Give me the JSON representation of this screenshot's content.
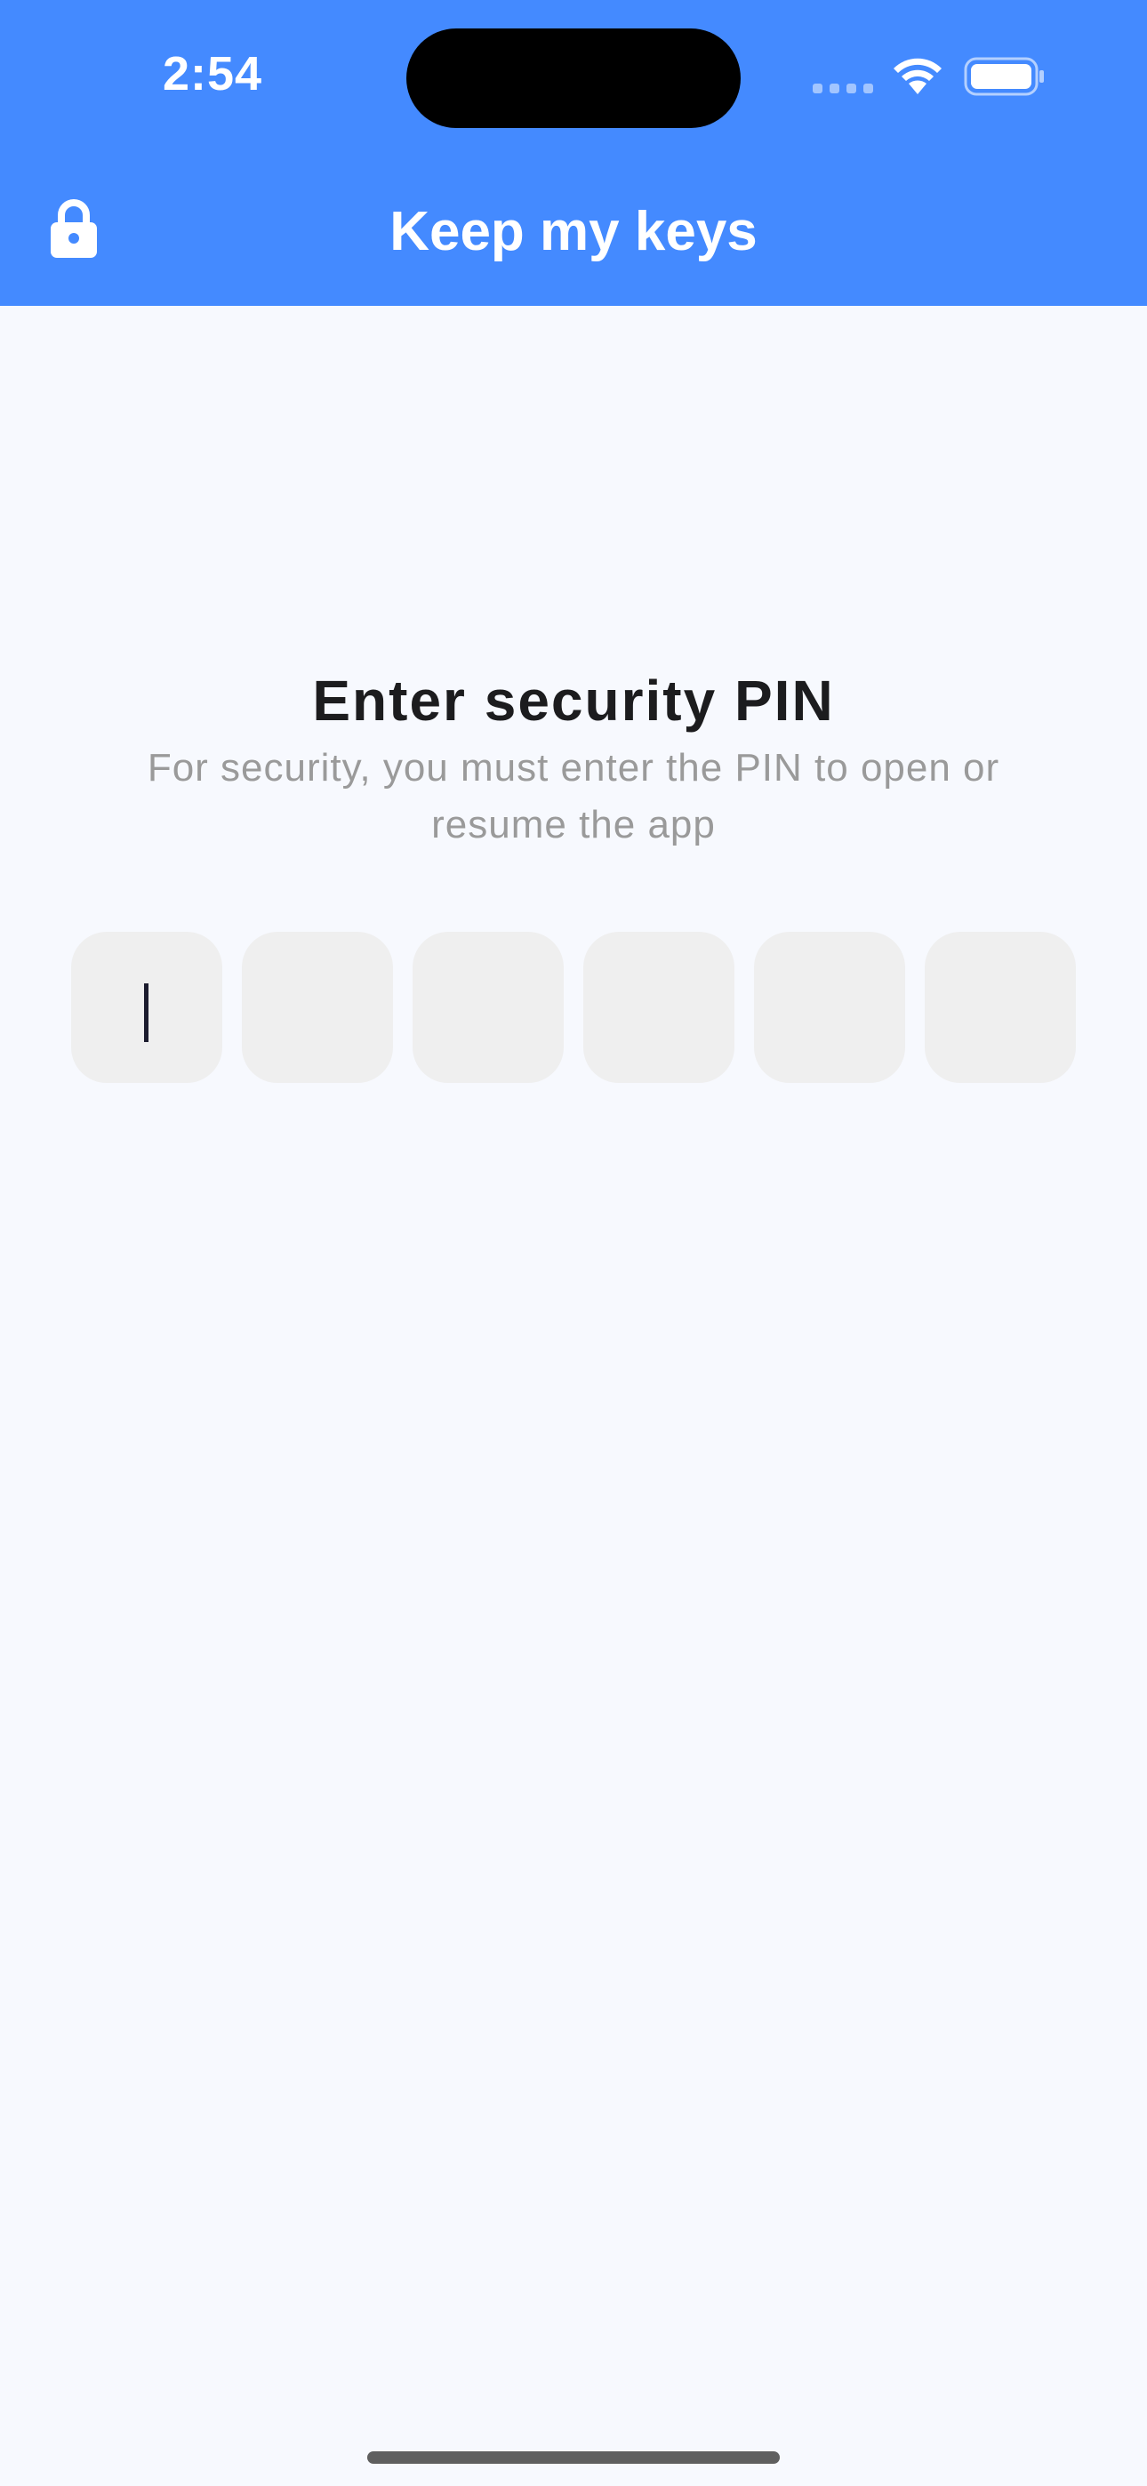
{
  "status_bar": {
    "time": "2:54"
  },
  "app_bar": {
    "title": "Keep my keys",
    "icon": "lock-icon"
  },
  "pin_screen": {
    "title": "Enter security PIN",
    "subtitle": "For security, you must enter the PIN to open or resume the app",
    "digit_count": 6,
    "digits": [
      "",
      "",
      "",
      "",
      "",
      ""
    ],
    "focused_index": 0
  },
  "colors": {
    "primary": "#448aff",
    "background": "#f7f9fe",
    "pin_box": "#efefef",
    "title_text": "#1c1c1e",
    "subtitle_text": "#9a9a9a"
  }
}
